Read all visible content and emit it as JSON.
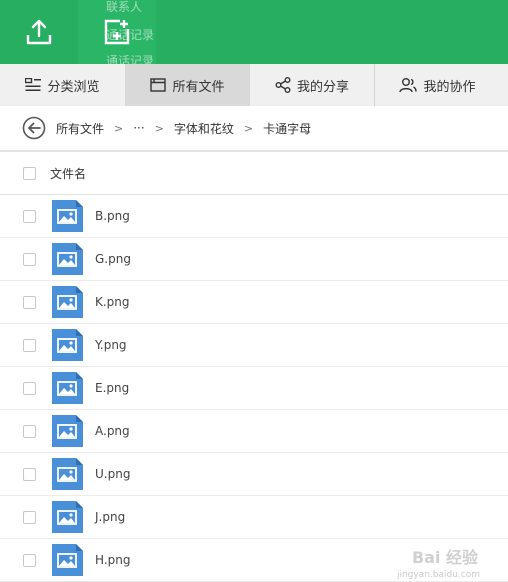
{
  "toolbar": {
    "upload_icon": "upload-icon",
    "new_icon": "new-file-icon",
    "ghost_items": [
      "联系人",
      "通话记录",
      "通话记录"
    ]
  },
  "tabs": [
    {
      "label": "分类浏览",
      "icon": "category-icon"
    },
    {
      "label": "所有文件",
      "icon": "folder-icon"
    },
    {
      "label": "我的分享",
      "icon": "share-icon"
    },
    {
      "label": "我的协作",
      "icon": "collab-icon"
    }
  ],
  "breadcrumb": {
    "items": [
      "所有文件",
      "···",
      "字体和花纹",
      "卡通字母"
    ],
    "separator": ">"
  },
  "table": {
    "header": "文件名",
    "files": [
      "B.png",
      "G.png",
      "K.png",
      "Y.png",
      "E.png",
      "A.png",
      "U.png",
      "J.png",
      "H.png"
    ]
  },
  "watermark": {
    "text": "Bai 经验",
    "sub": "jingyan.baidu.com"
  },
  "colors": {
    "accent": "#27ae60",
    "file_icon": "#4a90d9"
  }
}
